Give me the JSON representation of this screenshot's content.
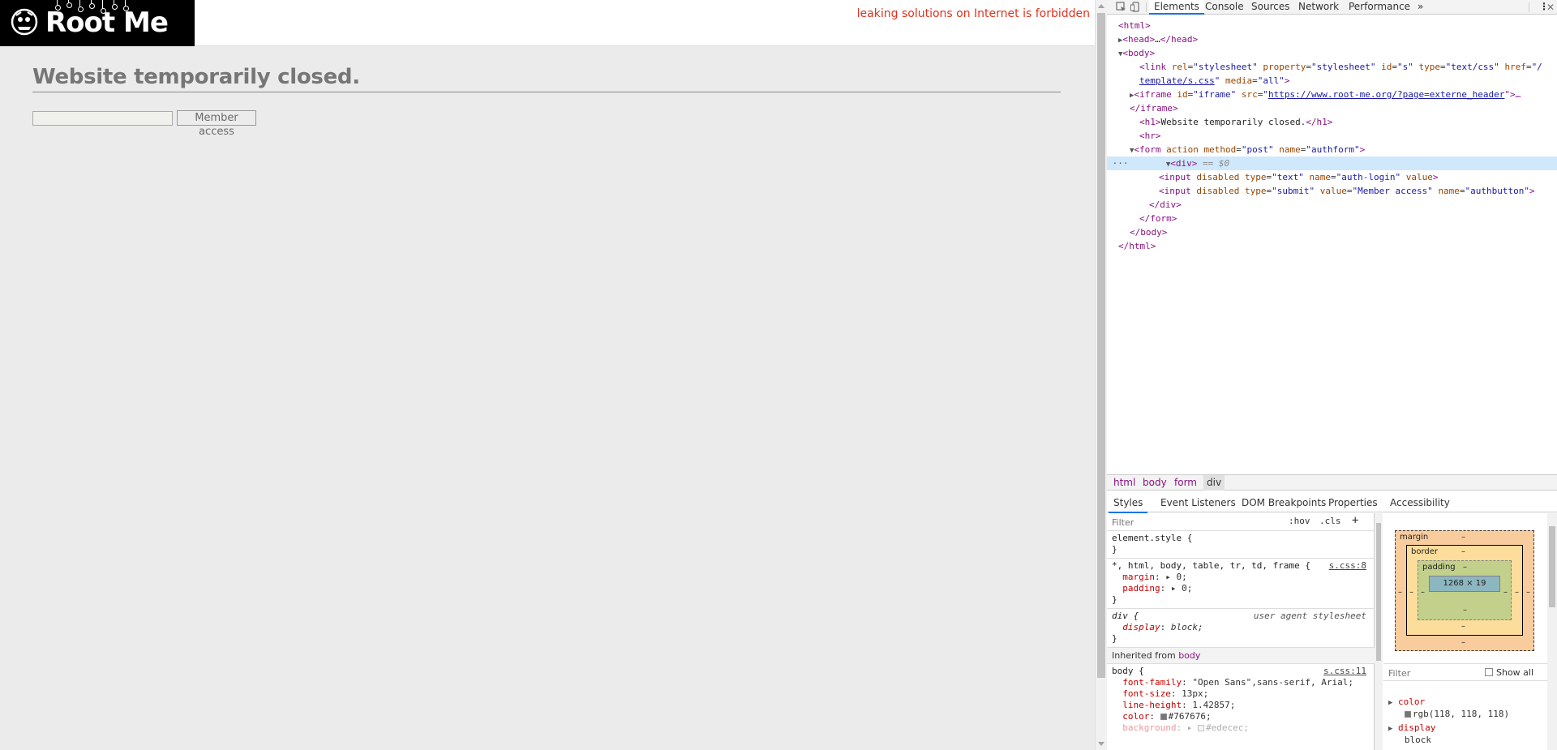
{
  "site": {
    "logo_text": "Root Me",
    "warning": "leaking solutions on Internet is forbidden",
    "heading": "Website temporarily closed.",
    "login_input_value": "",
    "member_button_label": "Member access"
  },
  "devtools": {
    "tabs": [
      "Elements",
      "Console",
      "Sources",
      "Network",
      "Performance"
    ],
    "more_tabs": "»",
    "kebab": "⋮",
    "tree": {
      "l1": "<html>",
      "l2a": "<head>",
      "l2b": "…",
      "l2c": "</head>",
      "l3": "<body>",
      "l4_tag": "<link",
      "l4_rel_attr": "rel",
      "l4_rel": "\"stylesheet\"",
      "l4_prop_attr": "property",
      "l4_prop": "\"stylesheet\"",
      "l4_id_attr": "id",
      "l4_id": "\"s\"",
      "l4_type_attr": "type",
      "l4_type": "\"text/css\"",
      "l4_href_attr": "href",
      "l4_href_a": "\"/",
      "l4_href_b": "template/s.css",
      "l4_media_attr": "media",
      "l4_media": "\"all\"",
      "l4_end": ">",
      "l5_tag": "<iframe",
      "l5_id_attr": "id",
      "l5_id": "\"iframe\"",
      "l5_src_attr": "src",
      "l5_src": "https://www.root-me.org/?page=externe_header",
      "l5_end": "\">…",
      "l6": "</iframe>",
      "l7_open": "<h1>",
      "l7_text": "Website temporarily closed.",
      "l7_close": "</h1>",
      "l8": "<hr>",
      "l9_tag": "<form",
      "l9_action_attr": "action",
      "l9_method_attr": "method",
      "l9_method": "\"post\"",
      "l9_name_attr": "name",
      "l9_name": "\"authform\"",
      "l9_end": ">",
      "l10_tag": "<div>",
      "l10_eq": "== $0",
      "l11_tag": "<input",
      "l11_disabled": "disabled",
      "l11_type_attr": "type",
      "l11_type": "\"text\"",
      "l11_name_attr": "name",
      "l11_name": "\"auth-login\"",
      "l11_value_attr": "value",
      "l11_end": ">",
      "l12_tag": "<input",
      "l12_disabled": "disabled",
      "l12_type_attr": "type",
      "l12_type": "\"submit\"",
      "l12_value_attr": "value",
      "l12_value": "\"Member access\"",
      "l12_name_attr": "name",
      "l12_name": "\"authbutton\"",
      "l12_end": ">",
      "l13": "</div>",
      "l14": "</form>",
      "l15": "</body>",
      "l16": "</html>"
    },
    "breadcrumbs": [
      "html",
      "body",
      "form",
      "div"
    ],
    "sub_tabs": [
      "Styles",
      "Event Listeners",
      "DOM Breakpoints",
      "Properties",
      "Accessibility"
    ],
    "styles": {
      "filter_placeholder": "Filter",
      "hov": ":hov",
      "cls": ".cls",
      "add": "+",
      "element_style": "element.style {",
      "close_brace": "}",
      "rule1_selector": "*, html, body, table, tr, td, frame {",
      "rule1_source": "s.css:8",
      "rule1_p1_name": "margin",
      "rule1_p1_val": "0;",
      "rule1_p2_name": "padding",
      "rule1_p2_val": "0;",
      "rule2_selector": "div {",
      "rule2_source": "user agent stylesheet",
      "rule2_p1_name": "display",
      "rule2_p1_val": "block;",
      "inherited_label": "Inherited from",
      "inherited_from": "body",
      "rule3_selector": "body {",
      "rule3_source": "s.css:11",
      "rule3_p1_name": "font-family",
      "rule3_p1_val": "\"Open Sans\",sans-serif, Arial;",
      "rule3_p2_name": "font-size",
      "rule3_p2_val": "13px;",
      "rule3_p3_name": "line-height",
      "rule3_p3_val": "1.42857;",
      "rule3_p4_name": "color",
      "rule3_p4_val": "#767676;",
      "rule3_p5_name": "background",
      "rule3_p5_val": "#edecec;"
    },
    "box_model": {
      "margin_label": "margin",
      "border_label": "border",
      "padding_label": "padding",
      "content_size": "1268 × 19",
      "dash": "–"
    },
    "computed": {
      "filter_placeholder": "Filter",
      "show_all": "Show all",
      "p1_name": "color",
      "p1_val": "rgb(118, 118, 118)",
      "p2_name": "display",
      "p2_val": "block"
    }
  },
  "colors": {
    "warning": "#e0321e",
    "heading": "#767676",
    "body_bg": "#ebebeb",
    "swatch_color": "#767676",
    "swatch_bg": "#edecec"
  }
}
